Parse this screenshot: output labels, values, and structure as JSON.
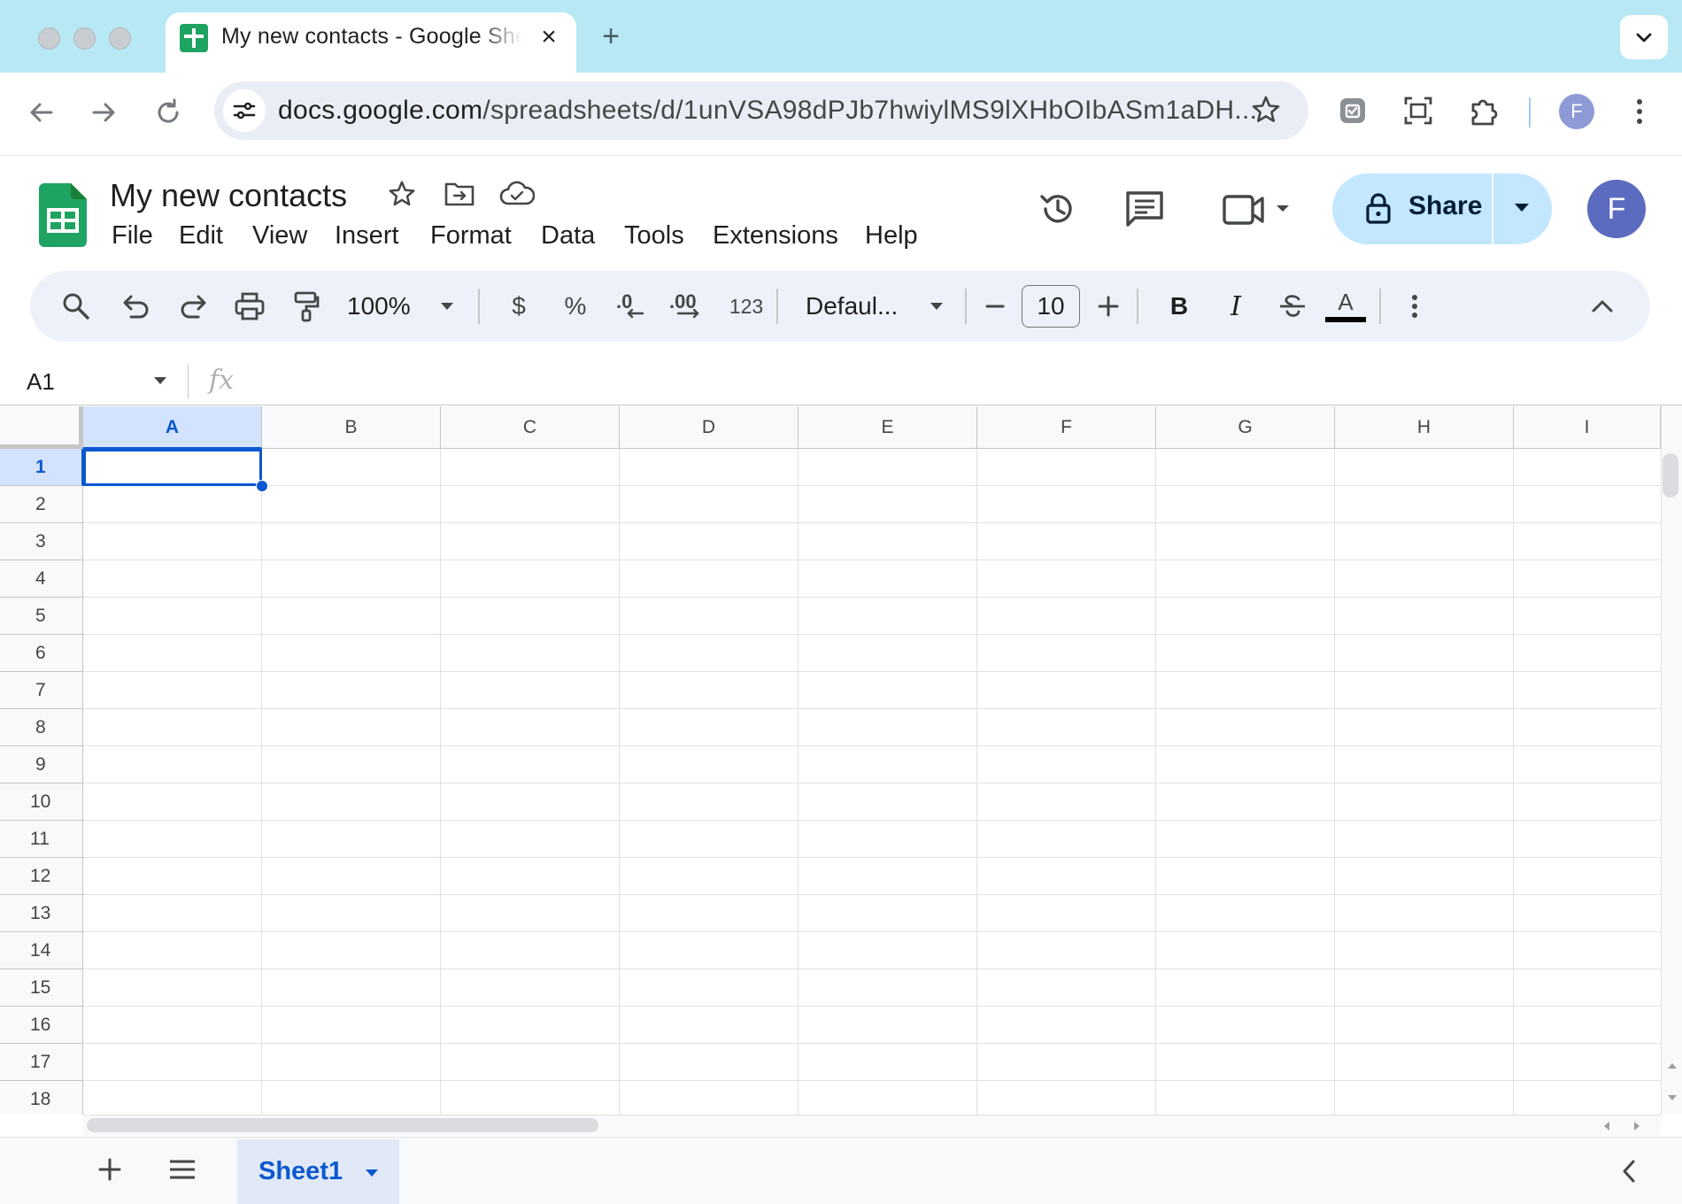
{
  "browser": {
    "tab_title": "My new contacts - Google Sheets",
    "url_host": "docs.google.com",
    "url_path": "/spreadsheets/d/1unVSA98dPJb7hwiylMS9lXHbOIbASm1aDH...",
    "profile_initial": "F"
  },
  "app": {
    "doc_title": "My new contacts",
    "menu": [
      "File",
      "Edit",
      "View",
      "Insert",
      "Format",
      "Data",
      "Tools",
      "Extensions",
      "Help"
    ],
    "share_label": "Share",
    "avatar_initial": "F"
  },
  "toolbar": {
    "zoom": "100%",
    "currency": "$",
    "percent": "%",
    "decimal_decrease": ".0",
    "decimal_increase": ".00",
    "number_format": "123",
    "font": "Defaul...",
    "font_size": "10",
    "bold": "B",
    "italic": "I",
    "text_color": "A"
  },
  "formula_bar": {
    "name_box": "A1",
    "fx": "fx"
  },
  "grid": {
    "columns": [
      "A",
      "B",
      "C",
      "D",
      "E",
      "F",
      "G",
      "H",
      "I"
    ],
    "rows": [
      "1",
      "2",
      "3",
      "4",
      "5",
      "6",
      "7",
      "8",
      "9",
      "10",
      "11",
      "12",
      "13",
      "14",
      "15",
      "16",
      "17",
      "18"
    ],
    "selected_cell": "A1"
  },
  "sheets": {
    "tabs": [
      "Sheet1"
    ]
  },
  "colors": {
    "accent": "#0b57d0",
    "share_bg": "#c2e7ff",
    "tabstrip": "#b7e8f3",
    "sheets_green": "#1ea362"
  }
}
